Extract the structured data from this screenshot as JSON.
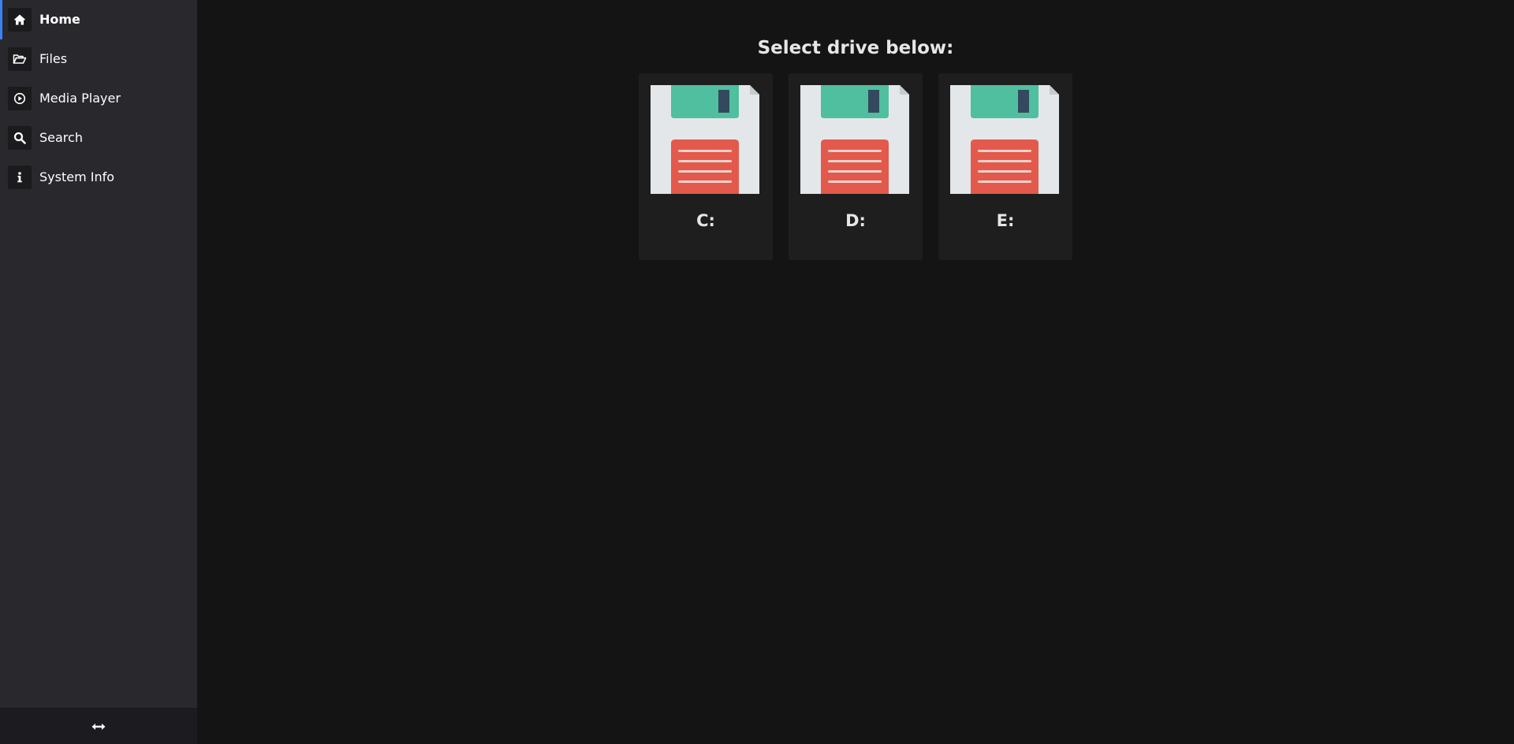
{
  "sidebar": {
    "items": [
      {
        "label": "Home",
        "icon": "home-icon",
        "active": true
      },
      {
        "label": "Files",
        "icon": "folder-open-icon",
        "active": false
      },
      {
        "label": "Media Player",
        "icon": "play-circle-icon",
        "active": false
      },
      {
        "label": "Search",
        "icon": "search-icon",
        "active": false
      },
      {
        "label": "System Info",
        "icon": "info-icon",
        "active": false
      }
    ],
    "footer_icon": "resize-horizontal-icon"
  },
  "main": {
    "title": "Select drive below:",
    "drives": [
      {
        "label": "C:",
        "icon": "floppy-disk-icon"
      },
      {
        "label": "D:",
        "icon": "floppy-disk-icon"
      },
      {
        "label": "E:",
        "icon": "floppy-disk-icon"
      }
    ]
  },
  "colors": {
    "accent": "#3b82f6",
    "sidebar_bg": "#28282d",
    "main_bg": "#141414",
    "card_bg": "#1e1e1e",
    "floppy_body": "#e3e7ea",
    "floppy_shutter": "#4fbf9f",
    "floppy_label": "#e3594b",
    "floppy_slot": "#34495e"
  }
}
